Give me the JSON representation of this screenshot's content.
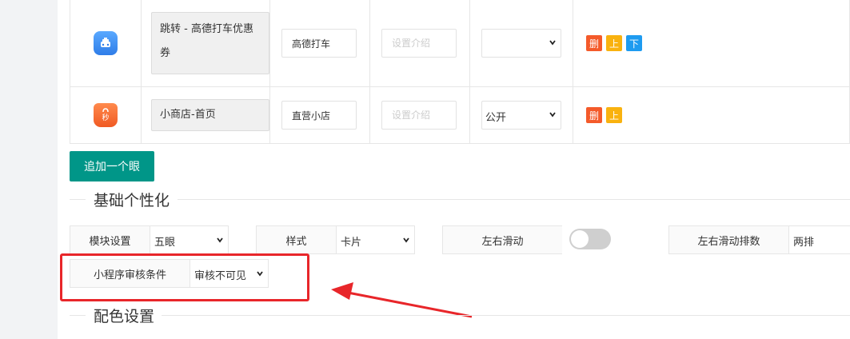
{
  "rows": [
    {
      "name": "跳转 - 高德打车优惠券",
      "short": "高德打车",
      "desc_placeholder": "设置介绍",
      "visibility": "",
      "buttons": [
        "删",
        "上",
        "下"
      ],
      "icon": "taxi-app-icon"
    },
    {
      "name": "小商店-首页",
      "short": "直营小店",
      "desc_placeholder": "设置介绍",
      "visibility": "公开",
      "buttons": [
        "删",
        "上"
      ],
      "icon": "shop-bag-icon"
    }
  ],
  "add_button": "追加一个眼",
  "sections": {
    "basic": "基础个性化",
    "color": "配色设置"
  },
  "settings": {
    "module_label": "模块设置",
    "module_value": "五眼",
    "style_label": "样式",
    "style_value": "卡片",
    "slide_label": "左右滑动",
    "slide_on": false,
    "slide_rows_label": "左右滑动排数",
    "slide_rows_value": "两排",
    "audit_label": "小程序审核条件",
    "audit_value": "审核不可见"
  },
  "colors": {
    "primary": "#009688",
    "del": "#f45a2a",
    "up": "#f9b20f",
    "down": "#1e9bf0",
    "highlight": "#e8262a"
  }
}
